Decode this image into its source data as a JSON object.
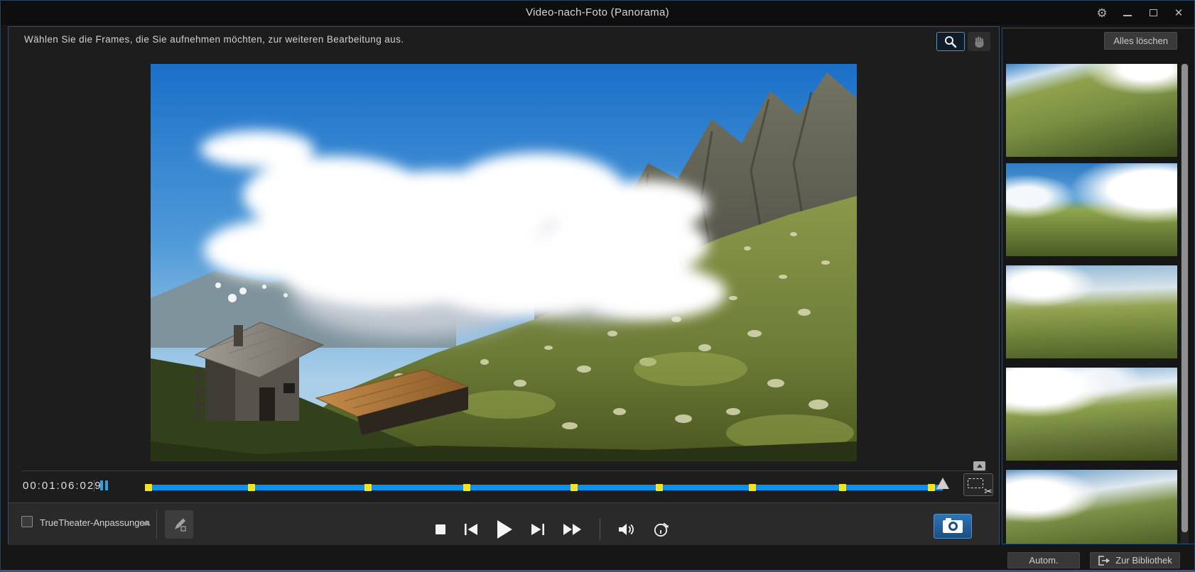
{
  "window": {
    "title": "Video-nach-Foto (Panorama)"
  },
  "toolbar": {
    "instruction": "Wählen Sie die Frames, die Sie aufnehmen möchten, zur weiteren Bearbeitung aus.",
    "clear_all_label": "Alles löschen",
    "zoom_tool_selected": true,
    "hand_tool_enabled": false
  },
  "player": {
    "timecode": "00:01:06:029",
    "playback_indicator": "pause"
  },
  "timeline": {
    "markers_pct": [
      0,
      13.4,
      28,
      40.3,
      53.8,
      64.5,
      76.1,
      87.4,
      99
    ],
    "filled_pct": 100
  },
  "truetheater": {
    "label": "TrueTheater-Anpassungen",
    "checked": false
  },
  "footer": {
    "auto_label": "Autom.",
    "library_label": "Zur Bibliothek"
  },
  "thumbnails": {
    "count": 5
  },
  "colors": {
    "timeline_blue": "#0a93ea",
    "marker_yellow": "#f2e424",
    "accent_blue": "#2f9fe8",
    "camera_button_blue": "#1f5c9c",
    "panel_border_blue": "#2d5078"
  }
}
